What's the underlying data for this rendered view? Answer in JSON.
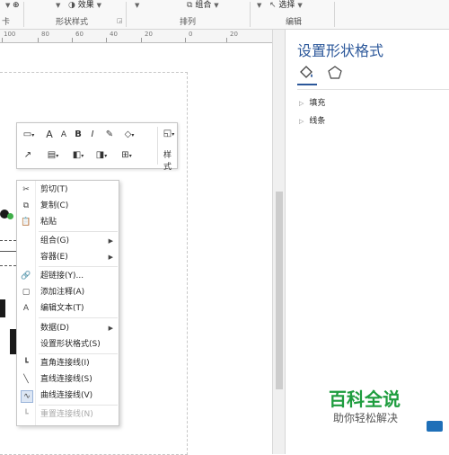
{
  "ribbon": {
    "effects_label": "效果",
    "group_shape_label": "组合",
    "select_label": "选择",
    "shape_styles_group": "形状样式",
    "arrange_group": "排列",
    "editing_group": "编辑"
  },
  "ruler": {
    "ticks": [
      "100",
      "80",
      "60",
      "40",
      "20",
      "0",
      "20"
    ]
  },
  "mini_toolbar": {
    "font_grow": "A",
    "font_shrink": "A",
    "bold": "B",
    "italic": "I",
    "style_label": "样式"
  },
  "context_menu": {
    "items": [
      {
        "label": "剪切(T)",
        "icon": "scissors-icon"
      },
      {
        "label": "复制(C)",
        "icon": "copy-icon"
      },
      {
        "label": "粘贴",
        "icon": "paste-icon"
      },
      {
        "label": "组合(G)",
        "submenu": true
      },
      {
        "label": "容器(E)",
        "submenu": true
      },
      {
        "label": "超链接(Y)...",
        "icon": "link-icon"
      },
      {
        "label": "添加注释(A)",
        "icon": "comment-icon"
      },
      {
        "label": "编辑文本(T)",
        "icon": "edit-text-icon"
      },
      {
        "label": "数据(D)",
        "submenu": true
      },
      {
        "label": "设置形状格式(S)"
      },
      {
        "label": "直角连接线(I)",
        "icon": "right-angle-connector-icon"
      },
      {
        "label": "直线连接线(S)",
        "icon": "straight-connector-icon"
      },
      {
        "label": "曲线连接线(V)",
        "icon": "curved-connector-icon"
      },
      {
        "label": "重置连接线(N)",
        "icon": "reset-connector-icon",
        "disabled": true
      }
    ]
  },
  "format_pane": {
    "title": "设置形状格式",
    "sections": [
      "填充",
      "线条"
    ]
  },
  "watermark": {
    "logo": "百科全说",
    "tagline": "助你轻松解决"
  },
  "colors": {
    "accent": "#2b579a",
    "watermark_green": "#1f9d3f"
  }
}
